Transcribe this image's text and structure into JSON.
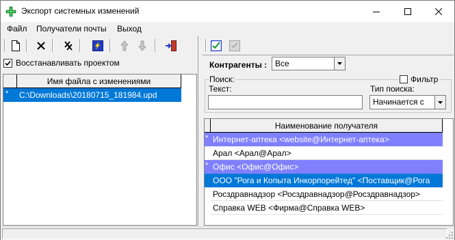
{
  "window": {
    "title": "Экспорт системных изменений"
  },
  "menu": {
    "items": [
      "Файл",
      "Получатели почты",
      "Выход"
    ]
  },
  "left": {
    "restore_checkbox_label": "Восстанавливать проектом",
    "restore_checked": true,
    "grid": {
      "column": "Имя файла с изменениями",
      "rows": [
        {
          "marker": "*",
          "value": "C:\\Downloads\\20180715_181984.upd",
          "selected": true
        }
      ]
    }
  },
  "right": {
    "contractors_label": "Контрагенты :",
    "contractors_value": "Все",
    "search_group_label": "Поиск:",
    "filter_label": "Фильтр",
    "filter_checked": false,
    "text_label": "Текст:",
    "text_value": "",
    "search_type_label": "Тип поиска:",
    "search_type_value": "Начинается с",
    "grid": {
      "column": "Наименование получателя",
      "rows": [
        {
          "marker": "*",
          "value": "Интернет-аптека <website@Интернет-аптека>",
          "state": "marked"
        },
        {
          "marker": "",
          "value": "Арал <Арал@Арал>",
          "state": "normal"
        },
        {
          "marker": "*",
          "value": "Офис <Офис@Офис>",
          "state": "marked"
        },
        {
          "marker": "",
          "value": "ООО \"Рога и Копыта Инкорпорейтед\" <Поставщик@Рога",
          "state": "selected"
        },
        {
          "marker": "",
          "value": "Росздравнадзор <Росздравнадзор@Росздравнадзор>",
          "state": "normal"
        },
        {
          "marker": "",
          "value": "Справка WEB <Фирма@Справка WEB>",
          "state": "normal"
        }
      ]
    }
  },
  "colors": {
    "selected": "#0078d7",
    "marked": "#8080ff",
    "accent_green": "#1e9e3a"
  }
}
